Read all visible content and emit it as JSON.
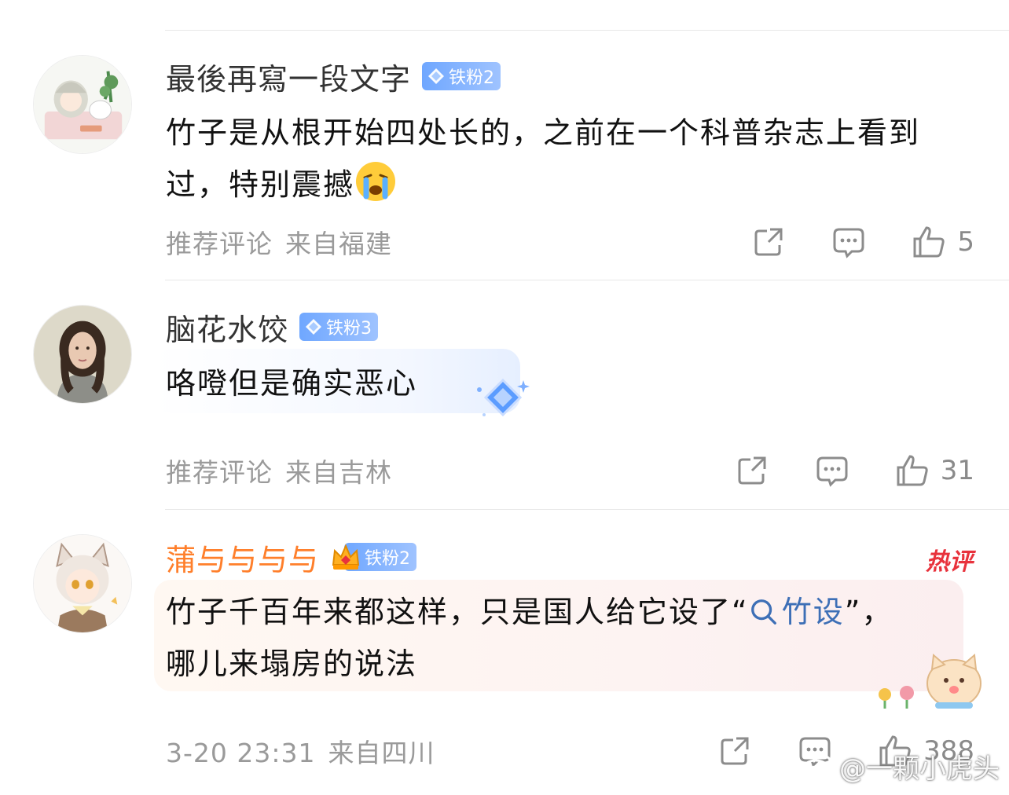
{
  "comments": [
    {
      "username": "最後再寫一段文字",
      "badge": "铁粉2",
      "text": "竹子是从根开始四处长的，之前在一个科普杂志上看到过，特别震撼",
      "meta_tag": "推荐评论",
      "location": "来自福建",
      "likes": "5",
      "avatar_icon": "illustrated-girl-avatar"
    },
    {
      "username": "脑花水饺",
      "badge": "铁粉3",
      "text": "咯噔但是确实恶心",
      "meta_tag": "推荐评论",
      "location": "来自吉林",
      "likes": "31",
      "avatar_icon": "portrait-photo-avatar"
    },
    {
      "username": "蒲与与与与",
      "badge": "铁粉2",
      "text_before_link": "竹子千百年来都这样，只是国人给它设了“",
      "link_text": "竹设",
      "text_after_link": "”，哪儿来塌房的说法",
      "hot_label": "热评",
      "timestamp": "3-20 23:31",
      "location": "来自四川",
      "likes": "388",
      "avatar_icon": "anime-cat-boy-avatar"
    }
  ],
  "watermark": "@一颗小虎头",
  "colors": {
    "username_default": "#333333",
    "username_vip": "#ff7f2b",
    "meta": "#9a9a9a",
    "badge": "#6fa7ff",
    "hot": "#e8323c",
    "link": "#3d6fb6"
  }
}
